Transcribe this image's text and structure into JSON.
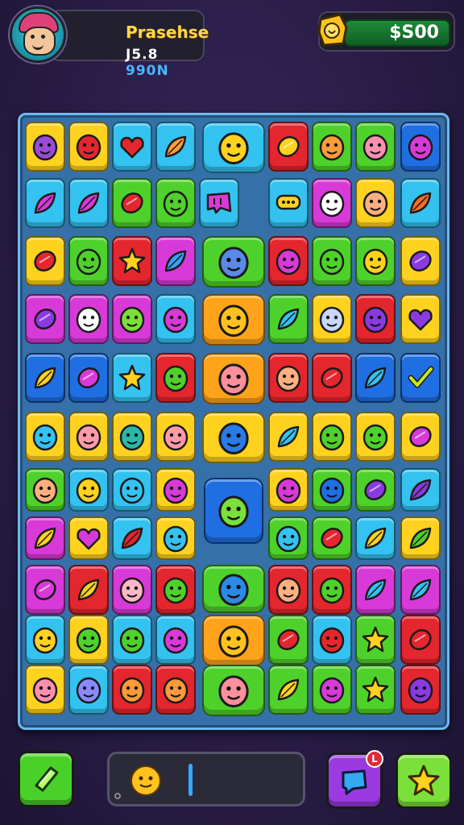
{
  "header": {
    "player_name": "Prasehse",
    "player_score_main": "J5.8 ",
    "player_score_tail": "990N",
    "currency": "$S00"
  },
  "icons": {
    "avatar": "avatar-icon",
    "coin": "coin-icon",
    "left_button": "gem-icon",
    "right_button": "star-icon",
    "chat_button": "chat-icon"
  },
  "footer": {
    "notification_count": "L",
    "progress_level": 0.38
  },
  "palette": {
    "yellow": "#ffd21f",
    "red": "#e4262e",
    "green": "#4fd12b",
    "cyan": "#34c2f0",
    "blue": "#1f6fe3",
    "magenta": "#d83ad8",
    "orange": "#ffa31a",
    "pink": "#ff7fb0",
    "purple": "#8a3ae0"
  },
  "board": {
    "rows": [
      [
        [
          "yellow",
          "face",
          "#9b4ad8"
        ],
        [
          "yellow",
          "face",
          "#e4262e"
        ],
        [
          "cyan",
          "heart",
          "#e4262e"
        ],
        [
          "cyan",
          "leaf",
          "#ff9a3a"
        ],
        [
          "big:cyan",
          "face",
          "#ffd21f"
        ],
        [
          "red",
          "gem",
          "#ffd21f"
        ],
        [
          "green",
          "face",
          "#ff9a3a"
        ],
        [
          "green",
          "face",
          "#ff8fb0"
        ],
        [
          "blue",
          "face",
          "#d83ad8"
        ]
      ],
      [
        [
          "cyan",
          "leaf",
          "#d83ad8"
        ],
        [
          "cyan",
          "leaf",
          "#d83ad8"
        ],
        [
          "green",
          "gem",
          "#e4262e"
        ],
        [
          "green",
          "face",
          "#4fd12b"
        ],
        [
          "wide:cyan",
          "puzzle",
          "#d83ad8"
        ],
        [
          "pad:cyan",
          "chat",
          "#ffd21f"
        ],
        [
          "magenta",
          "face",
          "#ffffff"
        ],
        [
          "yellow",
          "face",
          "#ffb080"
        ],
        [
          "cyan",
          "leaf",
          "#ff6a2a"
        ]
      ],
      [
        [
          "yellow",
          "gem",
          "#e4262e"
        ],
        [
          "green",
          "face",
          "#4fd12b"
        ],
        [
          "red",
          "star",
          "#ffd21f"
        ],
        [
          "magenta",
          "leaf",
          "#3aa0ff"
        ],
        [
          "big:green",
          "face",
          "#5a8ae8"
        ],
        [
          "red",
          "face",
          "#d83ad8"
        ],
        [
          "green",
          "face",
          "#4fd12b"
        ],
        [
          "green",
          "face",
          "#ffd21f"
        ],
        [
          "yellow",
          "gem",
          "#8a3ae0"
        ]
      ],
      [
        [
          "magenta",
          "gem",
          "#8a3ae0"
        ],
        [
          "magenta",
          "face",
          "#ffffff"
        ],
        [
          "magenta",
          "face",
          "#7be03a"
        ],
        [
          "cyan",
          "face",
          "#d83ad8"
        ],
        [
          "big:orange",
          "face",
          "#ffc21f"
        ],
        [
          "green",
          "leaf",
          "#34c2f0"
        ],
        [
          "yellow",
          "face",
          "#c8d8ff"
        ],
        [
          "red",
          "face",
          "#8a3ae0"
        ],
        [
          "yellow",
          "heart",
          "#8a3ae0"
        ]
      ],
      [
        [
          "wide:blue",
          "leaf",
          "#ffd21f"
        ],
        [
          "pad:blue",
          "gem",
          "#d83ad8"
        ],
        [
          "cyan",
          "star",
          "#ffd21f"
        ],
        [
          "red",
          "face",
          "#4fd12b"
        ],
        [
          "big:orange",
          "face",
          "#ff8f9a"
        ],
        [
          "red",
          "face",
          "#ffb080"
        ],
        [
          "red",
          "gem",
          "#e4262e"
        ],
        [
          "blue",
          "leaf",
          "#34c2f0"
        ],
        [
          "blue",
          "check",
          "#c8e81f"
        ]
      ],
      [
        [
          "yellow",
          "face",
          "#34c2f0"
        ],
        [
          "yellow",
          "face",
          "#ff9aa8"
        ],
        [
          "yellow",
          "face",
          "#2ab8a8"
        ],
        [
          "yellow",
          "face",
          "#ff9aa8"
        ],
        [
          "big:yellow",
          "face",
          "#2a7ae8"
        ],
        [
          "yellow",
          "leaf",
          "#34c2f0"
        ],
        [
          "yellow",
          "face",
          "#4fd12b"
        ],
        [
          "yellow",
          "face",
          "#4fd12b"
        ],
        [
          "yellow",
          "gem",
          "#d83ad8"
        ]
      ],
      [
        [
          "green",
          "face",
          "#ffb080"
        ],
        [
          "cyan",
          "face",
          "#ffd21f"
        ],
        [
          "cyan",
          "face",
          "#34c2f0"
        ],
        [
          "yellow",
          "face",
          "#d83ad8"
        ],
        [
          "big:blue",
          "face",
          "#7be03a"
        ],
        [
          "yellow",
          "face",
          "#d83ad8"
        ],
        [
          "green",
          "face",
          "#1f6fe3"
        ],
        [
          "green",
          "gem",
          "#8a3ae0"
        ],
        [
          "cyan",
          "leaf",
          "#8a3ae0"
        ]
      ],
      [
        [
          "magenta",
          "leaf",
          "#ffd21f"
        ],
        [
          "yellow",
          "heart",
          "#d83ad8"
        ],
        [
          "cyan",
          "leaf",
          "#e4262e"
        ],
        [
          "yellow",
          "face",
          "#34c2f0"
        ],
        [
          "gap",
          "none",
          "#000"
        ],
        [
          "green",
          "face",
          "#34c2f0"
        ],
        [
          "green",
          "gem",
          "#e4262e"
        ],
        [
          "cyan",
          "leaf",
          "#ffd21f"
        ],
        [
          "yellow",
          "leaf",
          "#4fd12b"
        ]
      ],
      [
        [
          "magenta",
          "gem",
          "#d83ad8"
        ],
        [
          "red",
          "leaf",
          "#ffd21f"
        ],
        [
          "magenta",
          "face",
          "#ffb8c8"
        ],
        [
          "red",
          "face",
          "#4fd12b"
        ],
        [
          "big:green",
          "face",
          "#2a8ae8"
        ],
        [
          "red",
          "face",
          "#ffb080"
        ],
        [
          "red",
          "face",
          "#4fd12b"
        ],
        [
          "magenta",
          "leaf",
          "#34c2f0"
        ],
        [
          "magenta",
          "leaf",
          "#34c2f0"
        ]
      ],
      [
        [
          "cyan",
          "face",
          "#ffd21f"
        ],
        [
          "yellow",
          "face",
          "#4fd12b"
        ],
        [
          "cyan",
          "face",
          "#4fd12b"
        ],
        [
          "cyan",
          "face",
          "#d83ad8"
        ],
        [
          "big:orange",
          "face",
          "#ffc21f"
        ],
        [
          "green",
          "gem",
          "#e4262e"
        ],
        [
          "cyan",
          "face",
          "#e4262e"
        ],
        [
          "green",
          "star",
          "#ffd21f"
        ],
        [
          "red",
          "gem",
          "#e4262e"
        ]
      ],
      [
        [
          "yellow",
          "face",
          "#ff8fb0"
        ],
        [
          "cyan",
          "face",
          "#8a8aff"
        ],
        [
          "red",
          "face",
          "#ff9a3a"
        ],
        [
          "red",
          "face",
          "#ff9a3a"
        ],
        [
          "big:green",
          "face",
          "#ff8f9a"
        ],
        [
          "green",
          "leaf",
          "#ffd21f"
        ],
        [
          "green",
          "face",
          "#d83ad8"
        ],
        [
          "green",
          "star",
          "#ffd21f"
        ],
        [
          "red",
          "face",
          "#8a3ae0"
        ]
      ]
    ]
  }
}
